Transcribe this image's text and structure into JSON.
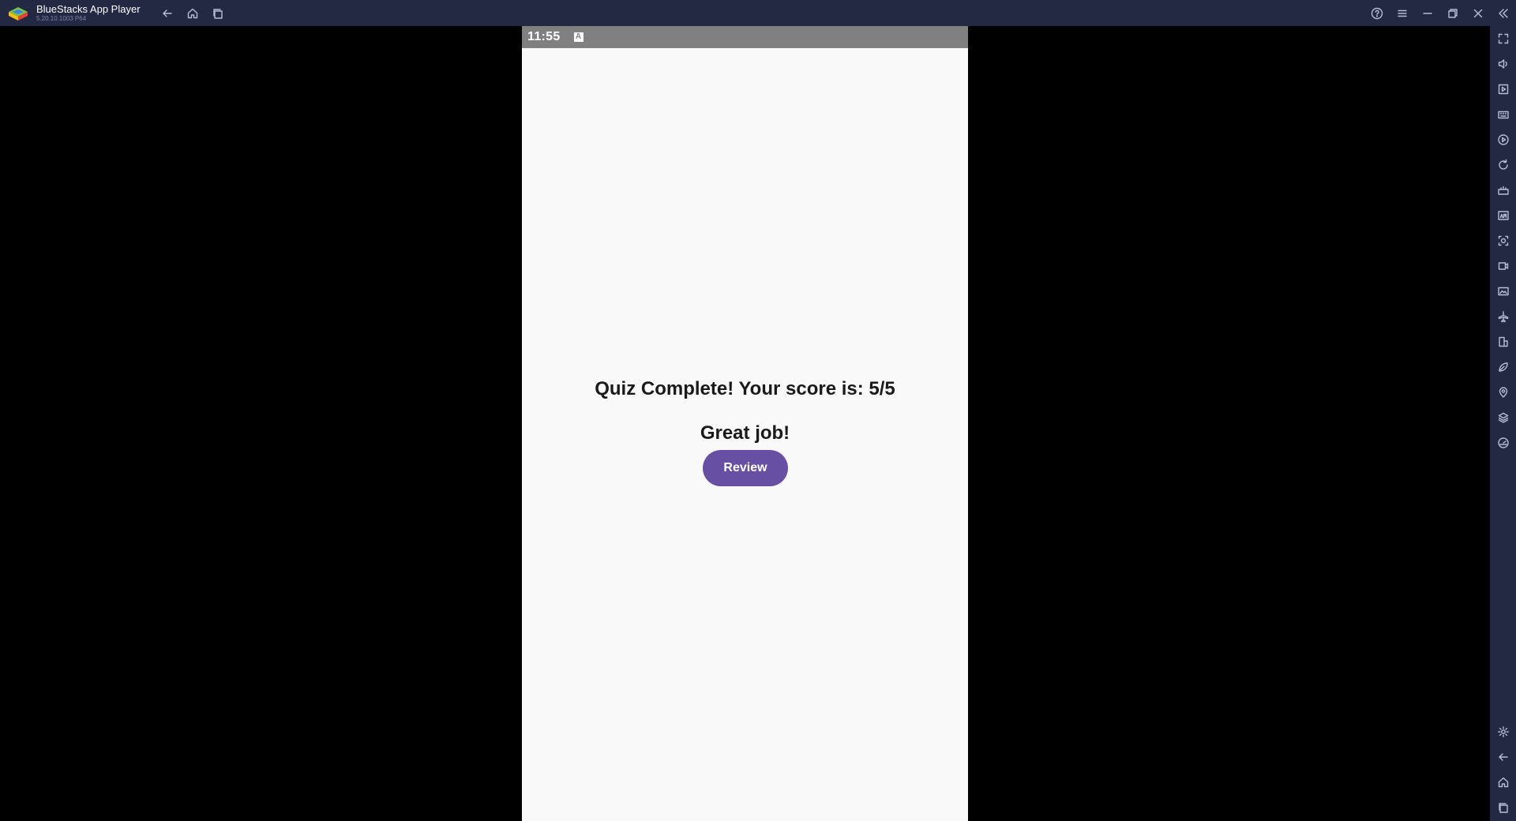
{
  "window": {
    "app_name": "BlueStacks App Player",
    "version": "5.20.10.1003 P64"
  },
  "nav": [
    {
      "name": "back-icon"
    },
    {
      "name": "home-icon"
    },
    {
      "name": "recent-apps-icon"
    }
  ],
  "window_controls": [
    {
      "name": "help-icon"
    },
    {
      "name": "menu-icon"
    },
    {
      "name": "minimize-icon"
    },
    {
      "name": "restore-icon"
    },
    {
      "name": "close-icon"
    },
    {
      "name": "collapse-sidebar-icon"
    }
  ],
  "android": {
    "status_time": "11:55",
    "status_icon": "A",
    "score_text": "Quiz Complete! Your score is: 5/5",
    "feedback_text": "Great job!",
    "review_label": "Review"
  },
  "sidebar_top": [
    "fullscreen-icon",
    "volume-icon",
    "media-icon",
    "keyboard-icon",
    "macro-play-icon",
    "rotate-icon",
    "game-controls-icon",
    "apk-install-icon",
    "screenshot-icon",
    "record-icon",
    "media-folder-icon",
    "airplane-icon",
    "multi-instance-icon",
    "eco-mode-icon",
    "location-icon",
    "layers-icon",
    "performance-icon"
  ],
  "sidebar_bottom": [
    "settings-icon",
    "android-back-icon",
    "android-home-icon",
    "android-recent-icon"
  ],
  "colors": {
    "titlebar": "#232843",
    "accent_button": "#6750a4",
    "statusbar": "#808080"
  }
}
